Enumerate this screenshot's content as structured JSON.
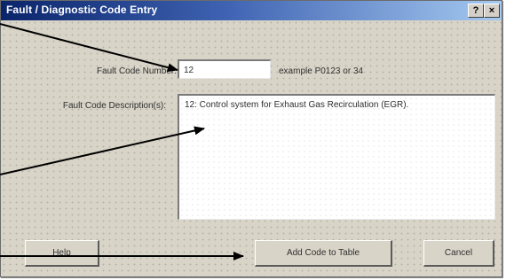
{
  "window": {
    "title": "Fault / Diagnostic Code Entry",
    "help_glyph": "?",
    "close_glyph": "×"
  },
  "form": {
    "fault_code_number_label": "Fault Code Number:",
    "fault_code_number_value": "12",
    "example_hint": "example P0123 or 34",
    "fault_code_description_label": "Fault Code Description(s):",
    "fault_code_description_value": "12: Control system for Exhaust Gas Recirculation (EGR)."
  },
  "buttons": {
    "help": "Help",
    "add_code": "Add Code to Table",
    "cancel": "Cancel"
  },
  "icons": {
    "help_icon": "question-mark-icon",
    "close_icon": "close-icon"
  },
  "colors": {
    "title_bar_start": "#0a246a",
    "title_bar_end": "#a6caf0",
    "dialog_face": "#d8d4c8"
  }
}
